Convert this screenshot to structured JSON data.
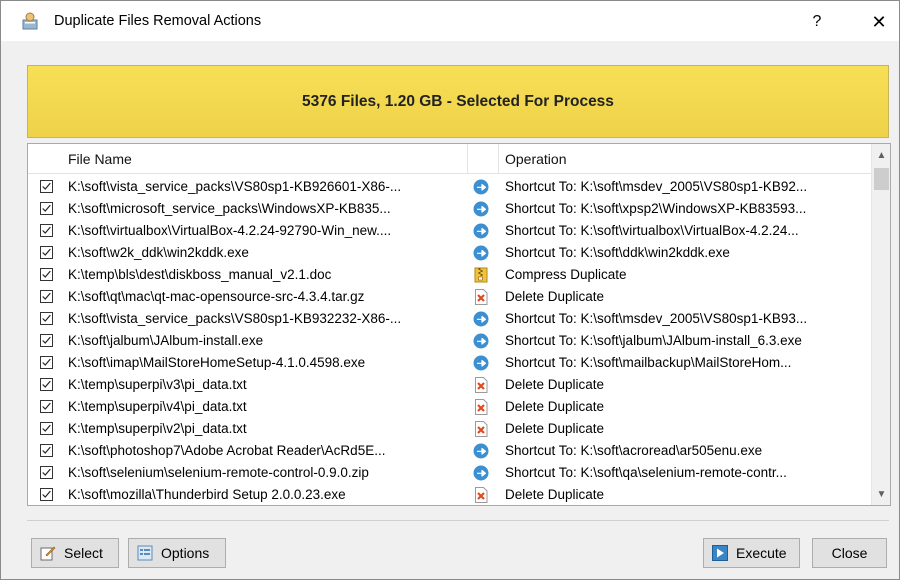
{
  "window": {
    "title": "Duplicate Files Removal Actions",
    "help_label": "?",
    "close_label": "✕"
  },
  "banner": {
    "text": "5376 Files, 1.20 GB - Selected For Process",
    "color": "#f3d94f"
  },
  "list": {
    "columns": [
      "File Name",
      "Operation"
    ],
    "rows": [
      {
        "file": "K:\\soft\\vista_service_packs\\VS80sp1-KB926601-X86-...",
        "op_icon": "shortcut-icon",
        "op": "Shortcut To: K:\\soft\\msdev_2005\\VS80sp1-KB92..."
      },
      {
        "file": "K:\\soft\\microsoft_service_packs\\WindowsXP-KB835...",
        "op_icon": "shortcut-icon",
        "op": "Shortcut To: K:\\soft\\xpsp2\\WindowsXP-KB83593..."
      },
      {
        "file": "K:\\soft\\virtualbox\\VirtualBox-4.2.24-92790-Win_new....",
        "op_icon": "shortcut-icon",
        "op": "Shortcut To: K:\\soft\\virtualbox\\VirtualBox-4.2.24..."
      },
      {
        "file": "K:\\soft\\w2k_ddk\\win2kddk.exe",
        "op_icon": "shortcut-icon",
        "op": "Shortcut To: K:\\soft\\ddk\\win2kddk.exe"
      },
      {
        "file": "K:\\temp\\bls\\dest\\diskboss_manual_v2.1.doc",
        "op_icon": "compress-icon",
        "op": "Compress Duplicate"
      },
      {
        "file": "K:\\soft\\qt\\mac\\qt-mac-opensource-src-4.3.4.tar.gz",
        "op_icon": "delete-icon",
        "op": "Delete Duplicate"
      },
      {
        "file": "K:\\soft\\vista_service_packs\\VS80sp1-KB932232-X86-...",
        "op_icon": "shortcut-icon",
        "op": "Shortcut To: K:\\soft\\msdev_2005\\VS80sp1-KB93..."
      },
      {
        "file": "K:\\soft\\jalbum\\JAlbum-install.exe",
        "op_icon": "shortcut-icon",
        "op": "Shortcut To: K:\\soft\\jalbum\\JAlbum-install_6.3.exe"
      },
      {
        "file": "K:\\soft\\imap\\MailStoreHomeSetup-4.1.0.4598.exe",
        "op_icon": "shortcut-icon",
        "op": "Shortcut To: K:\\soft\\mailbackup\\MailStoreHom..."
      },
      {
        "file": "K:\\temp\\superpi\\v3\\pi_data.txt",
        "op_icon": "delete-icon",
        "op": "Delete Duplicate"
      },
      {
        "file": "K:\\temp\\superpi\\v4\\pi_data.txt",
        "op_icon": "delete-icon",
        "op": "Delete Duplicate"
      },
      {
        "file": "K:\\temp\\superpi\\v2\\pi_data.txt",
        "op_icon": "delete-icon",
        "op": "Delete Duplicate"
      },
      {
        "file": "K:\\soft\\photoshop7\\Adobe Acrobat Reader\\AcRd5E...",
        "op_icon": "shortcut-icon",
        "op": "Shortcut To: K:\\soft\\acroread\\ar505enu.exe"
      },
      {
        "file": "K:\\soft\\selenium\\selenium-remote-control-0.9.0.zip",
        "op_icon": "shortcut-icon",
        "op": "Shortcut To: K:\\soft\\qa\\selenium-remote-contr..."
      },
      {
        "file": "K:\\soft\\mozilla\\Thunderbird Setup 2.0.0.23.exe",
        "op_icon": "delete-icon",
        "op": "Delete Duplicate"
      }
    ]
  },
  "buttons": {
    "select": "Select",
    "options": "Options",
    "execute": "Execute",
    "close": "Close"
  }
}
